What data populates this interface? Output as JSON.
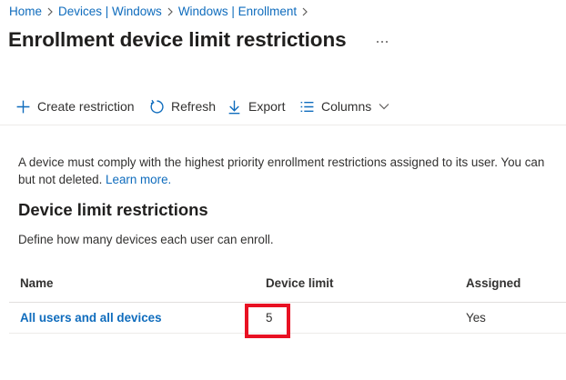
{
  "breadcrumb": {
    "items": [
      "Home",
      "Devices | Windows",
      "Windows | Enrollment"
    ]
  },
  "page": {
    "title": "Enrollment device limit restrictions",
    "more_label": "..."
  },
  "toolbar": {
    "create_label": "Create restriction",
    "refresh_label": "Refresh",
    "export_label": "Export",
    "columns_label": "Columns"
  },
  "description": {
    "line1": "A device must comply with the highest priority enrollment restrictions assigned to its user. You can",
    "line2_prefix": "but not deleted. ",
    "learn_more": "Learn more."
  },
  "section": {
    "title": "Device limit restrictions",
    "subtitle": "Define how many devices each user can enroll."
  },
  "table": {
    "columns": [
      "Name",
      "Device limit",
      "Assigned"
    ],
    "rows": [
      {
        "name": "All users and all devices",
        "device_limit": "5",
        "assigned": "Yes"
      }
    ]
  },
  "colors": {
    "link": "#0f6cbd",
    "highlight": "#e81123",
    "text": "#323130"
  },
  "icons": {
    "create": "plus-icon",
    "refresh": "refresh-icon",
    "export": "download-icon",
    "columns": "columns-list-icon",
    "columns_chevron": "chevron-down-icon",
    "breadcrumb_separator": "chevron-right-icon",
    "more": "more-horizontal-icon"
  }
}
